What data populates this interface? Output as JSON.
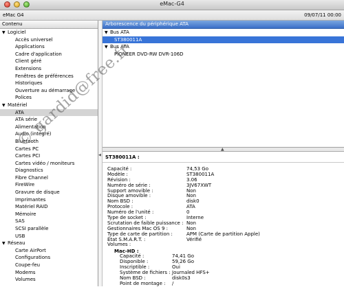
{
  "window": {
    "title": "eMac-G4"
  },
  "infobar": {
    "machine": "eMac G4",
    "date": "09/07/11 00:00"
  },
  "sidebar": {
    "header": "Contenu",
    "groups": [
      {
        "label": "Logiciel",
        "items": [
          "Accès universel",
          "Applications",
          "Cadre d'application",
          "Client géré",
          "Extensions",
          "Fenêtres de préférences",
          "Historiques",
          "Ouverture au démarrage",
          "Polices"
        ]
      },
      {
        "label": "Matériel",
        "items": [
          "ATA",
          "ATA série",
          "Alimentation",
          "Audio (intégré)",
          "Bluetooth",
          "Cartes PC",
          "Cartes PCI",
          "Cartes vidéo / moniteurs",
          "Diagnostics",
          "Fibre Channel",
          "FireWire",
          "Gravure de disque",
          "Imprimantes",
          "Matériel RAID",
          "Mémoire",
          "SAS",
          "SCSI parallèle",
          "USB"
        ]
      },
      {
        "label": "Réseau",
        "items": [
          "Carte AirPort",
          "Configurations",
          "Coupe-feu",
          "Modems",
          "Volumes"
        ]
      }
    ],
    "selected": "ATA"
  },
  "device_tree": {
    "header": "Arborescence du périphérique ATA",
    "buses": [
      {
        "label": "Bus ATA",
        "devices": [
          "ST380011A"
        ]
      },
      {
        "label": "Bus ATA",
        "devices": [
          "PIONEER DVD-RW  DVR-106D"
        ]
      }
    ],
    "selected": "ST380011A"
  },
  "detail": {
    "title": "ST380011A :",
    "rows": [
      {
        "k": "Capacité :",
        "v": "74,53 Go"
      },
      {
        "k": "Modèle :",
        "v": "ST380011A"
      },
      {
        "k": "Révision :",
        "v": "3.06"
      },
      {
        "k": "Numéro de série :",
        "v": "3JV67XWT"
      },
      {
        "k": "Support amovible :",
        "v": "Non"
      },
      {
        "k": "Disque amovible :",
        "v": "Non"
      },
      {
        "k": "Nom BSD :",
        "v": "disk0"
      },
      {
        "k": "Protocole :",
        "v": "ATA"
      },
      {
        "k": "Numéro de l'unité :",
        "v": "0"
      },
      {
        "k": "Type de socket :",
        "v": "Interne"
      },
      {
        "k": "Scrutation de faible puissance :",
        "v": "Non"
      },
      {
        "k": "Gestionnaires Mac OS 9 :",
        "v": "Non"
      },
      {
        "k": "Type de carte de partition :",
        "v": "APM (Carte de partition Apple)"
      },
      {
        "k": "État S.M.A.R.T. :",
        "v": "Vérifié"
      },
      {
        "k": "Volumes :",
        "v": ""
      }
    ],
    "volume": {
      "name": "Mac-HD :",
      "rows": [
        {
          "k": "Capacité :",
          "v": "74,41 Go"
        },
        {
          "k": "Disponible :",
          "v": "59,26 Go"
        },
        {
          "k": "Inscriptible :",
          "v": "Oui"
        },
        {
          "k": "Système de fichiers :",
          "v": "Journaled HFS+"
        },
        {
          "k": "Nom BSD :",
          "v": "disk0s3"
        },
        {
          "k": "Point de montage :",
          "v": "/"
        }
      ]
    }
  },
  "watermark": "© gardid@free.fr"
}
